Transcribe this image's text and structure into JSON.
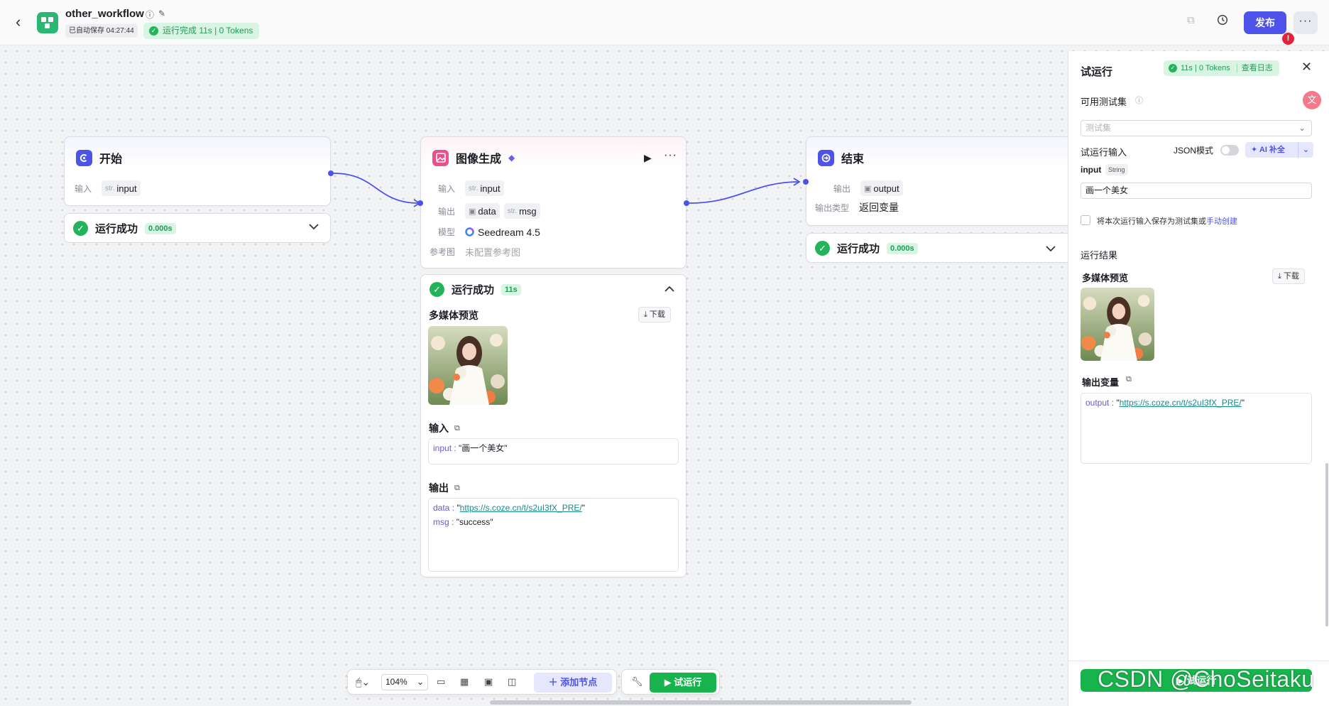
{
  "header": {
    "workflow_name": "other_workflow",
    "autosave": "已自动保存 04:27:44",
    "run_status": "运行完成 11s | 0 Tokens",
    "publish_label": "发布",
    "alert_mark": "!"
  },
  "nodes": {
    "start": {
      "title": "开始",
      "input_label": "输入",
      "input_type": "str.",
      "input_name": "input",
      "status": "运行成功",
      "duration": "0.000s"
    },
    "image_gen": {
      "title": "图像生成",
      "input_label": "输入",
      "input_type": "str.",
      "input_name": "input",
      "output_label": "输出",
      "output_1": "data",
      "output_2_type": "str.",
      "output_2": "msg",
      "model_label": "模型",
      "model_value": "Seedream 4.5",
      "ref_label": "参考图",
      "ref_value": "未配置参考图",
      "status": "运行成功",
      "duration": "11s",
      "media_preview": "多媒体预览",
      "download": "下载",
      "input_section": "输入",
      "input_key": "input",
      "input_value": "\"画一个美女\"",
      "output_section": "输出",
      "out_data_key": "data",
      "out_data_url": "https://s.coze.cn/t/s2uI3fX_PRE/",
      "out_msg_key": "msg",
      "out_msg_value": "\"success\""
    },
    "end": {
      "title": "结束",
      "output_label": "输出",
      "output_name": "output",
      "output_type_label": "输出类型",
      "output_type_value": "返回变量",
      "status": "运行成功",
      "duration": "0.000s"
    }
  },
  "toolbar": {
    "zoom": "104%",
    "add_node": "添加节点",
    "test_run": "试运行"
  },
  "panel": {
    "title": "试运行",
    "status": "11s | 0 Tokens",
    "view_log": "查看日志",
    "test_set_label": "可用测试集",
    "test_set_placeholder": "测试集",
    "run_input_label": "试运行输入",
    "json_mode": "JSON模式",
    "ai_fill": "AI 补全",
    "input_name": "input",
    "input_type": "String",
    "input_value": "画一个美女",
    "save_text": "将本次运行输入保存为测试集或",
    "manual_create": "手动创建",
    "result_label": "运行结果",
    "media_preview": "多媒体预览",
    "download": "下载",
    "output_var_label": "输出变量",
    "output_key": "output",
    "output_url": "https://s.coze.cn/t/s2uI3fX_PRE/",
    "run_button": "试运行"
  },
  "watermark": "CSDN @ChoSeitaku",
  "colors": {
    "accent": "#4d53e8",
    "success": "#22b45a",
    "run_button": "#17b34d"
  }
}
